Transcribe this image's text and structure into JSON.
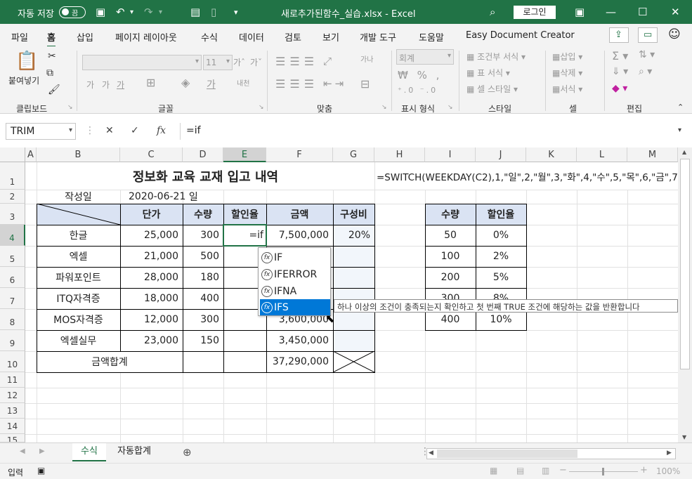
{
  "titlebar": {
    "autosave_label": "자동 저장",
    "autosave_state": "끔",
    "filename": "새로추가된함수_실습.xlsx",
    "app": "Excel",
    "separator": " - ",
    "login": "로그인"
  },
  "tabs": [
    "파일",
    "홈",
    "삽입",
    "페이지 레이아웃",
    "수식",
    "데이터",
    "검토",
    "보기",
    "개발 도구",
    "도움말",
    "Easy Document Creator"
  ],
  "ribbon": {
    "groups": [
      "클립보드",
      "글꼴",
      "맞춤",
      "표시 형식",
      "스타일",
      "셀",
      "편집"
    ],
    "paste_label": "붙여넣기",
    "font_size": "11",
    "number_format": "회계",
    "styles": [
      "조건부 서식",
      "표 서식",
      "셀 스타일"
    ],
    "cells": [
      "삽입",
      "삭제",
      "서식"
    ],
    "font_buttons": [
      "가",
      "가",
      "가"
    ],
    "font_grow": "가ˆ",
    "font_shrink": "가ˇ",
    "phonetic": "내천"
  },
  "formula_bar": {
    "namebox": "TRIM",
    "fx_label": "fx",
    "formula": "=if"
  },
  "columns": [
    "A",
    "B",
    "C",
    "D",
    "E",
    "F",
    "G",
    "H",
    "I",
    "J",
    "K",
    "L",
    "M"
  ],
  "rows": [
    "1",
    "2",
    "3",
    "4",
    "5",
    "6",
    "7",
    "8",
    "9",
    "10",
    "11",
    "12",
    "13",
    "14",
    "15"
  ],
  "sheet": {
    "title": "정보화 교육 교재 입고 내역",
    "switch_formula": "=SWITCH(WEEKDAY(C2),1,\"일\",2,\"월\",3,\"화\",4,\"수\",5,\"목\",6,\"금\",7,",
    "author_label": "작성일",
    "date": "2020-06-21",
    "day": "일",
    "headers": [
      "단가",
      "수량",
      "할인율",
      "금액",
      "구성비"
    ],
    "items": [
      {
        "name": "한글",
        "price": "25,000",
        "qty": "300",
        "amount": "7,500,000",
        "ratio": "20%"
      },
      {
        "name": "엑셀",
        "price": "21,000",
        "qty": "500",
        "amount": "",
        "ratio": ""
      },
      {
        "name": "파워포인트",
        "price": "28,000",
        "qty": "180",
        "amount": "",
        "ratio": ""
      },
      {
        "name": "ITQ자격증",
        "price": "18,000",
        "qty": "400",
        "amount": "",
        "ratio": ""
      },
      {
        "name": "MOS자격증",
        "price": "12,000",
        "qty": "300",
        "amount": "3,600,000",
        "ratio": ""
      },
      {
        "name": "엑셀실무",
        "price": "23,000",
        "qty": "150",
        "amount": "3,450,000",
        "ratio": ""
      }
    ],
    "editing_cell": "=if",
    "total_label": "금액합계",
    "total": "37,290,000",
    "discount_headers": [
      "수량",
      "할인율"
    ],
    "discount_table": [
      {
        "qty": "50",
        "rate": "0%"
      },
      {
        "qty": "100",
        "rate": "2%"
      },
      {
        "qty": "200",
        "rate": "5%"
      },
      {
        "qty": "300",
        "rate": "8%"
      },
      {
        "qty": "400",
        "rate": "10%"
      }
    ]
  },
  "autocomplete": {
    "items": [
      "IF",
      "IFERROR",
      "IFNA",
      "IFS"
    ],
    "selected": "IFS",
    "tooltip": "하나 이상의 조건이 충족되는지 확인하고 첫 번째 TRUE 조건에 해당하는 값을 반환합니다"
  },
  "sheet_tabs": [
    "수식",
    "자동합계"
  ],
  "status": {
    "mode": "입력",
    "zoom": "100%"
  },
  "colors": {
    "accent": "#217346",
    "header_fill": "#dae3f3",
    "highlight": "#0078d7"
  }
}
